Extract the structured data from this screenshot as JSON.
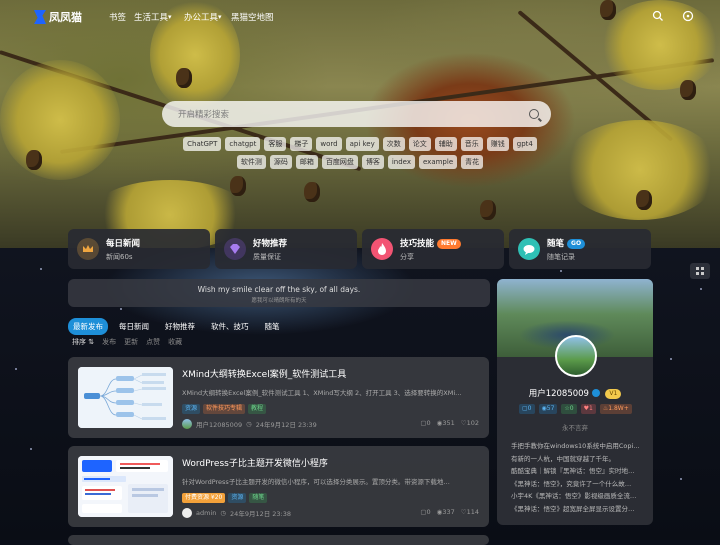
{
  "nav": {
    "logo": "凤凤猫",
    "items": [
      "书签",
      "生活工具",
      "办公工具",
      "黑猫空地图"
    ]
  },
  "search": {
    "placeholder": "开启精彩搜索"
  },
  "tags": [
    "ChatGPT",
    "chatgpt",
    "客服",
    "梯子",
    "word",
    "api key",
    "次数",
    "论文",
    "辅助",
    "音乐",
    "赚钱",
    "gpt4",
    "软件测",
    "源码",
    "邮箱",
    "百度网盘",
    "博客",
    "index",
    "example",
    "青花"
  ],
  "cards": [
    {
      "title": "每日新闻",
      "subtitle": "新闻60s",
      "icon": "crown-icon",
      "color": "#f0a640",
      "badge": ""
    },
    {
      "title": "好物推荐",
      "subtitle": "质量保证",
      "icon": "gem-icon",
      "color": "#8e5ce6",
      "badge": ""
    },
    {
      "title": "技巧技能",
      "subtitle": "分享",
      "icon": "flame-icon",
      "color": "#f25473",
      "badge": "NEW"
    },
    {
      "title": "随笔",
      "subtitle": "随笔记录",
      "icon": "chat-icon",
      "color": "#2fc0b5",
      "badge": "GO"
    }
  ],
  "quote": {
    "en": "Wish my smile clear off the sky, of all days.",
    "zh": "愿我可以晴朗所有的天"
  },
  "tabs": [
    "最新发布",
    "每日新闻",
    "好物推荐",
    "软件、技巧",
    "随笔"
  ],
  "sort": {
    "label": "排序",
    "options": [
      "发布",
      "更新",
      "点赞",
      "收藏"
    ]
  },
  "posts": [
    {
      "title": "XMind大纲转换Excel案例_软件测试工具",
      "desc": "XMind大纲转换Excel案例_软件测试工具 1、XMind写大纲 2、打开工具 3、选择要转换的XMi…",
      "tags": [
        "资源",
        "软件技巧专辑",
        "教程"
      ],
      "author": "用户12085009",
      "date": "24年9月12日 23:39",
      "comments": "0",
      "views": "351",
      "likes": "102"
    },
    {
      "title": "WordPress子比主题开发微信小程序",
      "desc": "针对WordPress子比主题开发的微信小程序，可以选择分类展示。置顶分类。带资源下载地…",
      "tags": [
        "付费资源 ¥20",
        "资源",
        "随笔"
      ],
      "author": "admin",
      "date": "24年9月12日 23:38",
      "comments": "0",
      "views": "337",
      "likes": "114"
    }
  ],
  "user": {
    "name": "用户12085009",
    "level": "V1",
    "stats": [
      "0",
      "57",
      "0",
      "1",
      "1.8W+"
    ],
    "signature": "永不言弃",
    "recent": [
      "手把手教你在windows10系统中启用Copi…",
      "有新的一人杭，中国就穿越了千年。",
      "酷酷宝典｜解锁『黑神话：悟空』实时地…",
      "《黑神话：悟空》，究竟许了一个什么故…",
      "小宇4K《黑神话：悟空》影视级画质全流…",
      "《黑神话：悟空》超宽屏全屏显示设置分…"
    ]
  }
}
